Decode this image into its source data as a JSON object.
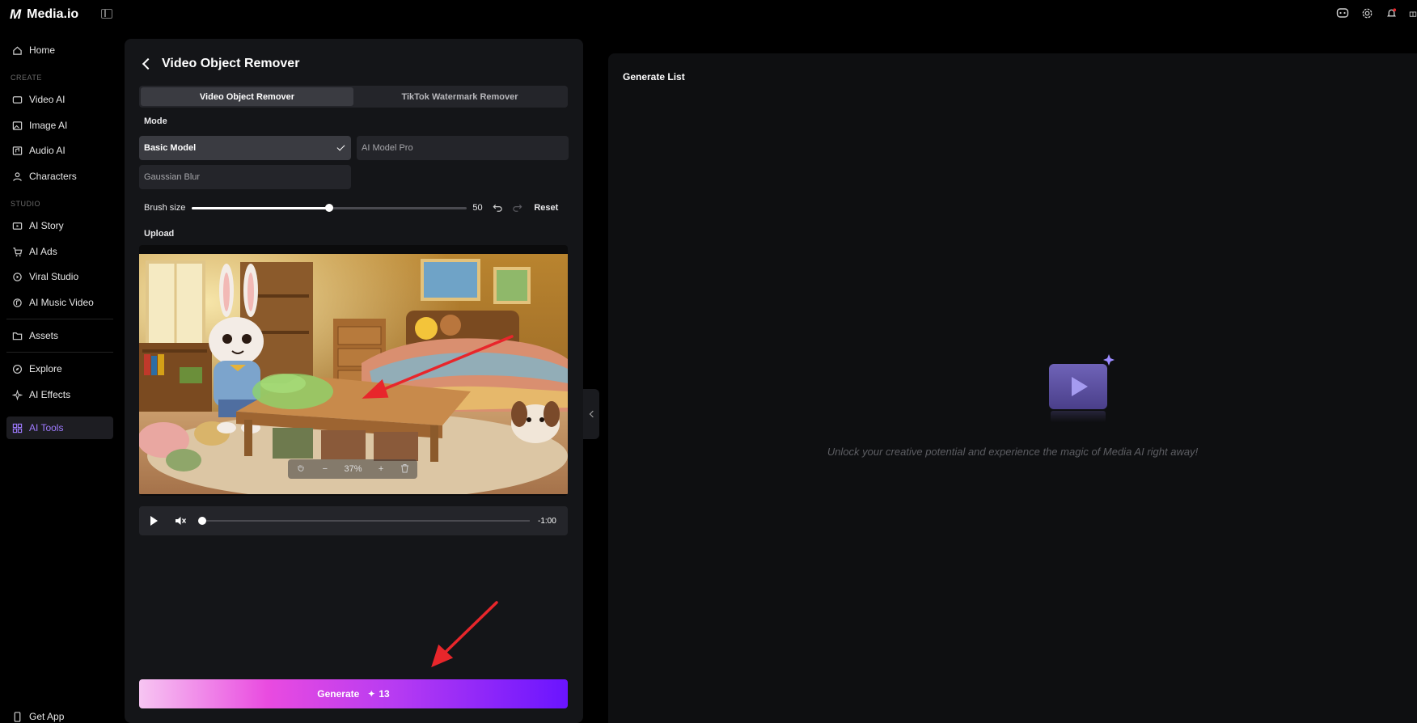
{
  "brand": {
    "logo": "M",
    "name": "Media.io"
  },
  "sidebar": {
    "items": [
      {
        "label": "Home",
        "icon": "home-icon"
      },
      {
        "section": "CREATE"
      },
      {
        "label": "Video AI",
        "icon": "video-icon"
      },
      {
        "label": "Image AI",
        "icon": "image-icon"
      },
      {
        "label": "Audio AI",
        "icon": "audio-icon"
      },
      {
        "label": "Characters",
        "icon": "user-icon"
      },
      {
        "section": "STUDIO"
      },
      {
        "label": "AI Story",
        "icon": "story-icon"
      },
      {
        "label": "AI Ads",
        "icon": "ads-icon"
      },
      {
        "label": "Viral Studio",
        "icon": "viral-icon"
      },
      {
        "label": "AI Music Video",
        "icon": "music-icon"
      },
      {
        "label": "Assets",
        "icon": "folder-icon"
      },
      {
        "label": "Explore",
        "icon": "compass-icon"
      },
      {
        "label": "AI Effects",
        "icon": "sparkle-icon"
      },
      {
        "label": "AI Tools",
        "icon": "tools-icon",
        "active": true
      },
      {
        "label": "Get App",
        "icon": "phone-icon"
      }
    ]
  },
  "panel": {
    "title": "Video Object Remover",
    "tabs": [
      "Video Object Remover",
      "TikTok Watermark Remover"
    ],
    "mode_label": "Mode",
    "modes": [
      "Basic Model",
      "AI Model Pro",
      "Gaussian Blur"
    ],
    "brush_label": "Brush size",
    "brush_value": "50",
    "brush_fraction": 0.5,
    "reset_label": "Reset",
    "upload_label": "Upload",
    "zoom_value": "37%",
    "time": "-1:00",
    "generate_label": "Generate",
    "generate_credits": "13"
  },
  "right": {
    "title": "Generate List",
    "empty_message": "Unlock your creative potential and experience the magic of Media AI right away!"
  },
  "colors": {
    "accent": "#9f7bff",
    "arrow": "#e8262b",
    "panel": "#141518"
  }
}
